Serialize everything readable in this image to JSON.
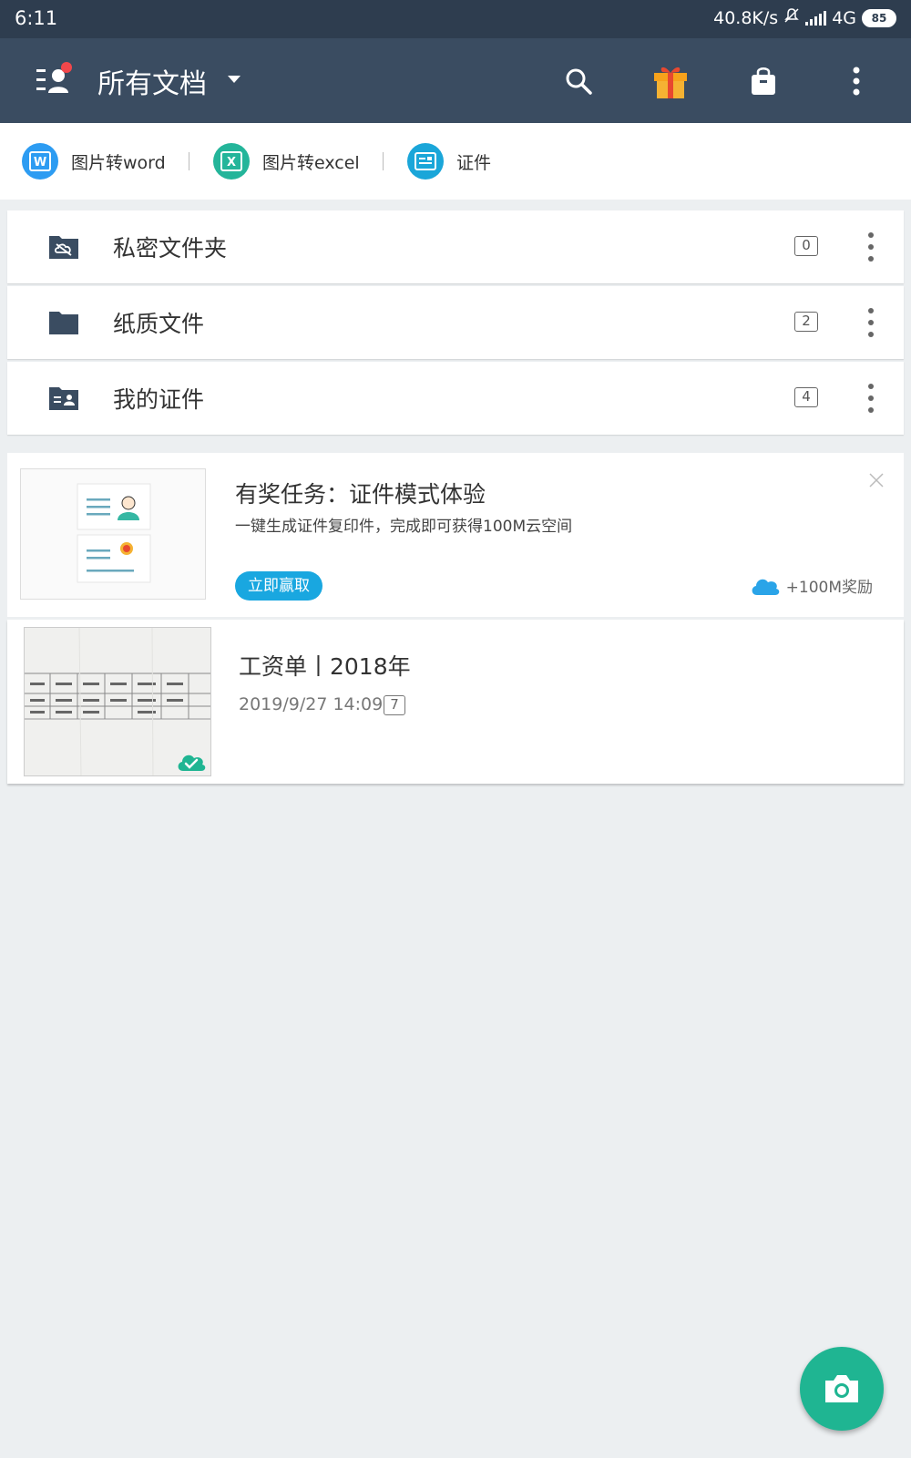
{
  "status_bar": {
    "time": "6:11",
    "net_speed": "40.8K/s",
    "network": "4G",
    "battery": "85"
  },
  "app_bar": {
    "title": "所有文档"
  },
  "quick_actions": [
    {
      "label": "图片转word",
      "color": "#2d9cf2"
    },
    {
      "label": "图片转excel",
      "color": "#24b59a"
    },
    {
      "label": "证件",
      "color": "#1aa6d9"
    }
  ],
  "folders": [
    {
      "name": "私密文件夹",
      "count": "0"
    },
    {
      "name": "纸质文件",
      "count": "2"
    },
    {
      "name": "我的证件",
      "count": "4"
    }
  ],
  "task": {
    "title": "有奖任务：证件模式体验",
    "description": "一键生成证件复印件，完成即可获得100M云空间",
    "button": "立即赢取",
    "reward": "+100M奖励"
  },
  "document": {
    "title": "工资单丨2018年",
    "date": "2019/9/27 14:09",
    "pages": "7"
  },
  "colors": {
    "status_bar": "#2e3d4f",
    "app_bar": "#3a4c61",
    "gift": "#f7a21b",
    "accent_blue": "#19a7e0",
    "fab": "#1fb592"
  }
}
